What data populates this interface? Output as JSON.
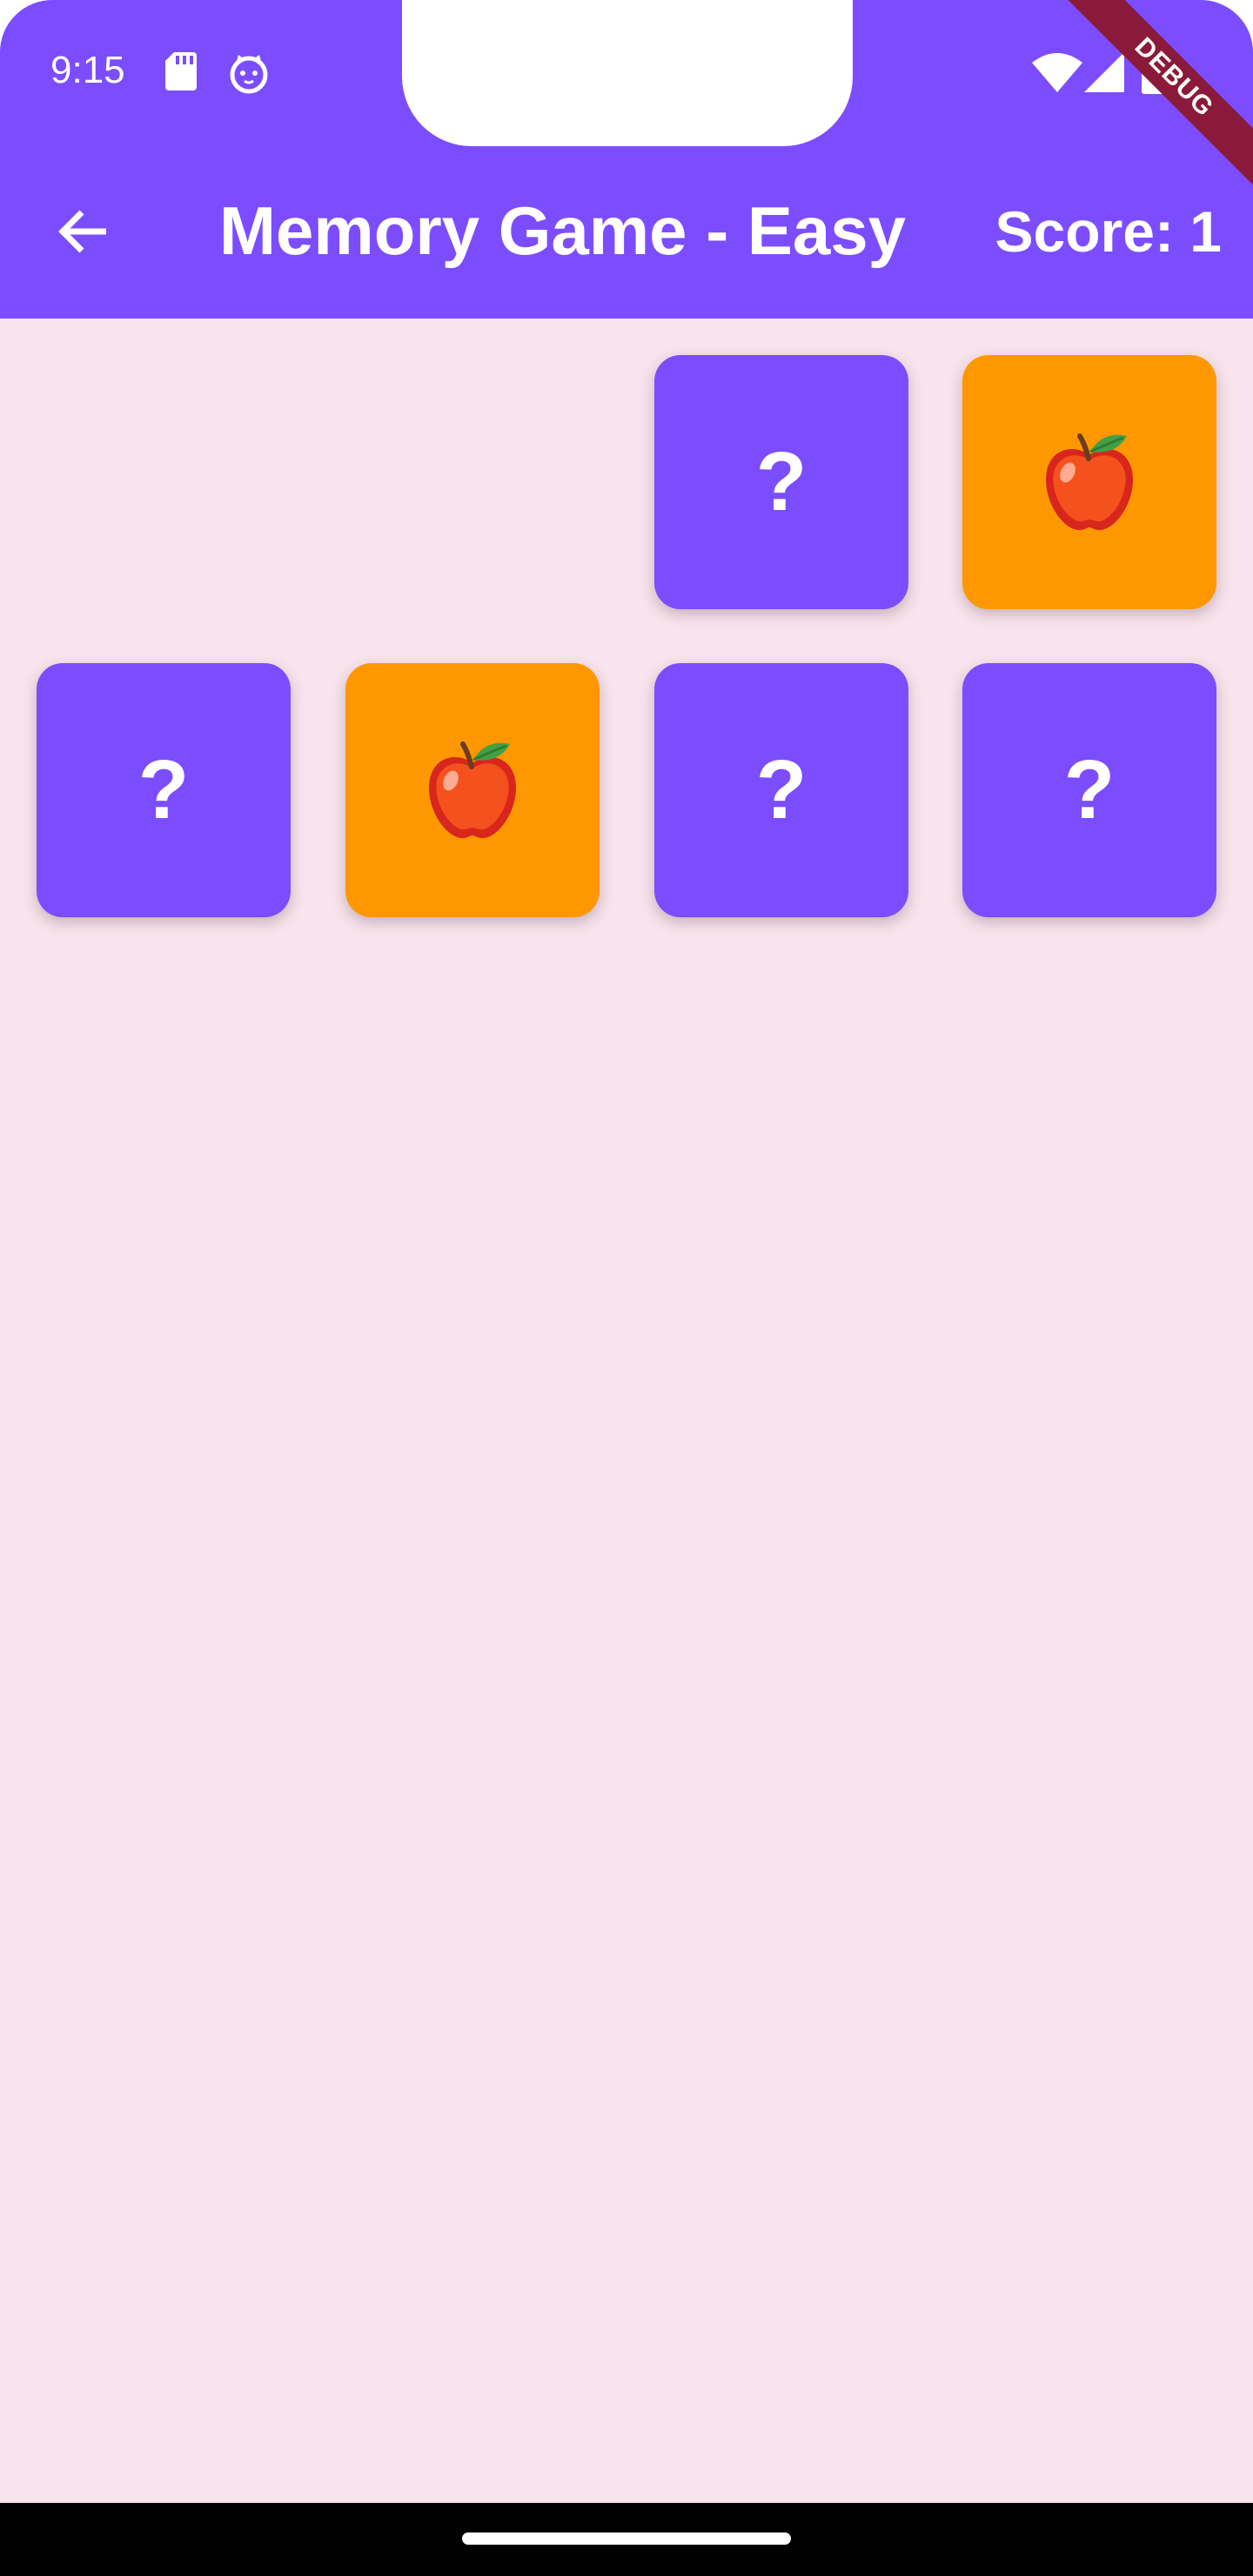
{
  "status_bar": {
    "time": "9:15",
    "icons": [
      "sd-card-icon",
      "cat-face-icon",
      "wifi-icon",
      "cell-signal-icon",
      "battery-icon"
    ]
  },
  "debug_banner": {
    "label": "DEBUG"
  },
  "app_bar": {
    "back_icon": "arrow-back-icon",
    "title": "Memory Game - Easy",
    "score": "Score: 1"
  },
  "colors": {
    "primary": "#7c4dff",
    "revealed_card": "#ff9800",
    "background": "#f8e4ec",
    "debug_ribbon": "#8b1a3a"
  },
  "cards": [
    {
      "state": "matched-removed",
      "symbol": ""
    },
    {
      "state": "matched-removed",
      "symbol": ""
    },
    {
      "state": "hidden",
      "symbol": "?"
    },
    {
      "state": "revealed",
      "symbol": "apple-icon"
    },
    {
      "state": "hidden",
      "symbol": "?"
    },
    {
      "state": "revealed",
      "symbol": "apple-icon"
    },
    {
      "state": "hidden",
      "symbol": "?"
    },
    {
      "state": "hidden",
      "symbol": "?"
    }
  ]
}
